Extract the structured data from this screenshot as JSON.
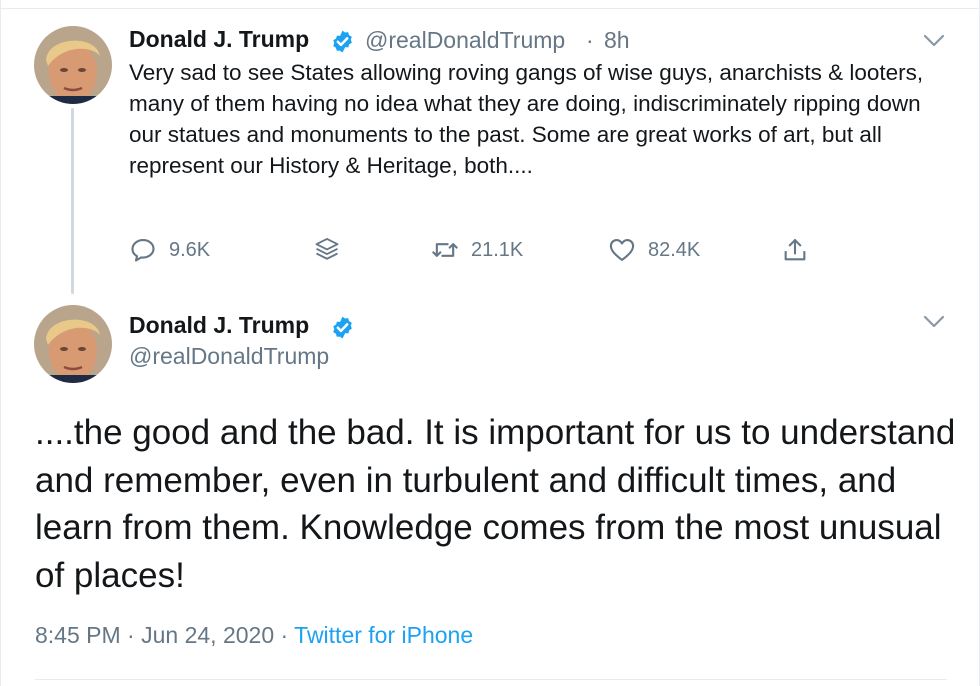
{
  "tweet1": {
    "author_name": "Donald J. Trump",
    "handle": "@realDonaldTrump",
    "separator": "·",
    "time": "8h",
    "text": "Very sad to see States allowing roving gangs of wise guys, anarchists & looters, many of them having no idea what they are doing, indiscriminately ripping down our statues and monuments to the past. Some are great works of art, but all represent our History & Heritage, both....",
    "actions": {
      "reply_count": "9.6K",
      "retweet_count": "21.1K",
      "like_count": "82.4K"
    }
  },
  "tweet2": {
    "author_name": "Donald J. Trump",
    "handle": "@realDonaldTrump",
    "text": "....the good and the bad. It is important for us to understand and remember, even in turbulent and difficult times, and learn from them. Knowledge comes from the most unusual of places!",
    "time": "8:45 PM",
    "date": "Jun 24, 2020",
    "separator": "·",
    "source": "Twitter for iPhone"
  },
  "icons": {
    "verified": "verified-badge-icon",
    "more": "chevron-down-icon",
    "reply": "reply-icon",
    "layers": "layers-icon",
    "retweet": "retweet-icon",
    "like": "heart-icon",
    "share": "share-icon"
  },
  "colors": {
    "text": "#14171a",
    "secondary": "#657786",
    "accent": "#1da1f2",
    "border": "#e6ecf0",
    "thread_line": "#cfd9de"
  }
}
